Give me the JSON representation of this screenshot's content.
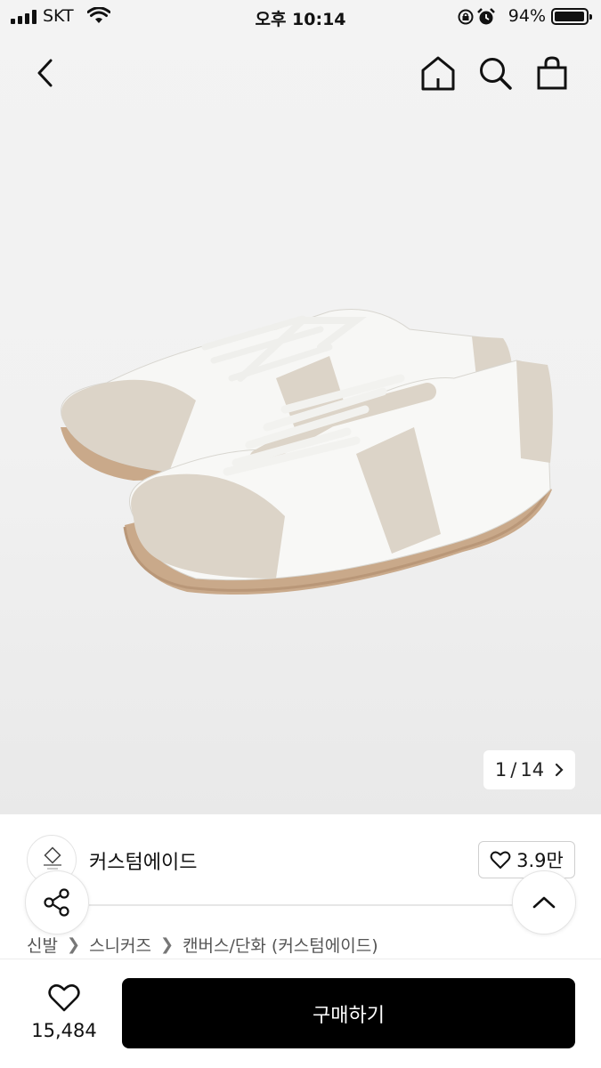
{
  "status_bar": {
    "carrier": "SKT",
    "time": "오후 10:14",
    "battery": "94%",
    "battery_level": 0.94
  },
  "nav": {
    "icons": [
      "back-chevron-icon",
      "home-icon",
      "search-icon",
      "shopping-bag-icon"
    ]
  },
  "gallery": {
    "current": "1",
    "separator": "/",
    "total": "14"
  },
  "brand": {
    "name": "커스텀에이드",
    "likes": "3.9만"
  },
  "breadcrumb": {
    "items": [
      "신발",
      "스니커즈",
      "캔버스/단화 (커스텀에이드)"
    ]
  },
  "footer": {
    "favorite_count": "15,484",
    "buy_label": "구매하기"
  },
  "colors": {
    "buy_button": "#000000",
    "sole": "#c9a98a",
    "suede": "#dcd4c8"
  }
}
